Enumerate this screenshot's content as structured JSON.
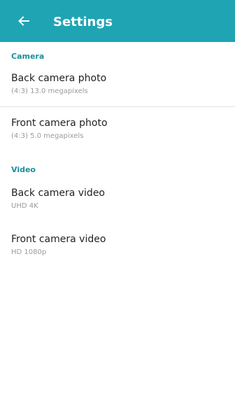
{
  "toolbar": {
    "title": "Settings",
    "back_icon": "arrow-left-icon",
    "background_color": "#1fa4b4"
  },
  "sections": {
    "camera": {
      "header": "Camera",
      "items": [
        {
          "title": "Back camera photo",
          "summary": "(4:3) 13.0 megapixels"
        },
        {
          "title": "Front camera photo",
          "summary": "(4:3) 5.0 megapixels"
        }
      ]
    },
    "video": {
      "header": "Video",
      "items": [
        {
          "title": "Back camera video",
          "summary": "UHD 4K"
        },
        {
          "title": "Front camera video",
          "summary": "HD 1080p"
        }
      ]
    }
  },
  "colors": {
    "accent": "#1a8f9c",
    "primary_text": "#222222",
    "secondary_text": "#9a9a9a"
  }
}
